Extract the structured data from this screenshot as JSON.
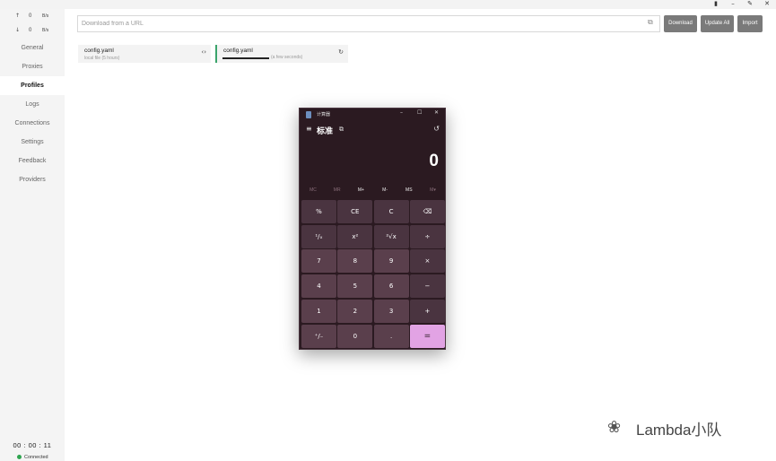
{
  "window": {
    "buttons": [
      "pin-icon",
      "minimize-icon",
      "pencil-icon",
      "close-icon"
    ]
  },
  "sidebar": {
    "traffic": {
      "up": {
        "value": "0",
        "unit": "B/s"
      },
      "down": {
        "value": "0",
        "unit": "B/s"
      }
    },
    "items": [
      {
        "label": "General",
        "active": false
      },
      {
        "label": "Proxies",
        "active": false
      },
      {
        "label": "Profiles",
        "active": true
      },
      {
        "label": "Logs",
        "active": false
      },
      {
        "label": "Connections",
        "active": false
      },
      {
        "label": "Settings",
        "active": false
      },
      {
        "label": "Feedback",
        "active": false
      },
      {
        "label": "Providers",
        "active": false
      }
    ],
    "timer": "00 : 00 : 11",
    "status": "Connected",
    "status_color": "#2ea44f"
  },
  "toolbar": {
    "url_placeholder": "Download from a URL",
    "download_label": "Download",
    "update_all_label": "Update All",
    "import_label": "Import"
  },
  "profiles": [
    {
      "name": "config.yaml",
      "detail": "local file (5 hours)",
      "action_icon": "code-icon"
    },
    {
      "name": "config.yaml",
      "detail": "(a few seconds)",
      "progress": 1.0,
      "action_icon": "refresh-icon"
    }
  ],
  "calculator": {
    "title": "计算器",
    "mode": "标准",
    "display": "0",
    "memory": [
      "MC",
      "MR",
      "M+",
      "M-",
      "MS",
      "M▾"
    ],
    "keys": [
      [
        "%",
        "CE",
        "C",
        "⌫"
      ],
      [
        "¹/ₓ",
        "x²",
        "²√x",
        "÷"
      ],
      [
        "7",
        "8",
        "9",
        "×"
      ],
      [
        "4",
        "5",
        "6",
        "−"
      ],
      [
        "1",
        "2",
        "3",
        "+"
      ],
      [
        "⁺/₋",
        "0",
        ".",
        "="
      ]
    ],
    "accent": "#e2a3e4"
  },
  "watermark": {
    "text": "Lambda小队"
  }
}
